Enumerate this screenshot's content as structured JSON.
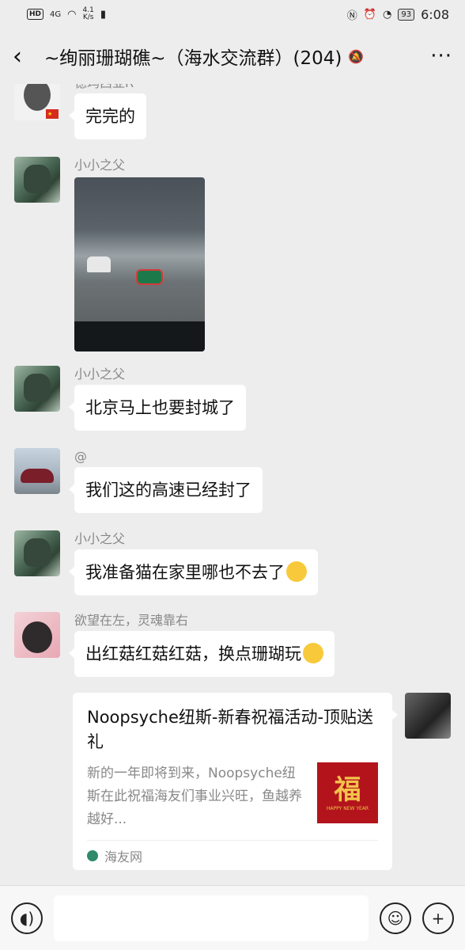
{
  "status_bar": {
    "hd": "HD",
    "network": "4G",
    "speed_value": "4.1",
    "speed_unit": "K/s",
    "battery": "93",
    "time": "6:08"
  },
  "header": {
    "back_icon": "chevron-left-icon",
    "title": "~绚丽珊瑚礁~（海水交流群）(204)",
    "mute_icon": "bell-muted-icon",
    "more_icon": "more-dots-icon",
    "more_label": "···"
  },
  "messages": [
    {
      "sender": "德玛西亚R",
      "text": "完完的"
    },
    {
      "sender": "小小之父",
      "type": "image"
    },
    {
      "sender": "小小之父",
      "text": "北京马上也要封城了"
    },
    {
      "sender": "@",
      "text": "我们这的高速已经封了"
    },
    {
      "sender": "小小之父",
      "text": "我准备猫在家里哪也不去了"
    },
    {
      "sender": "欲望在左，灵魂靠右",
      "text": "出红菇红菇红菇，换点珊瑚玩"
    }
  ],
  "share_card": {
    "title": "Noopsyche纽斯-新春祝福活动-顶贴送礼",
    "description": "新的一年即将到来，Noopsyche纽斯在此祝福海友们事业兴旺，鱼越养越好...",
    "thumb_text": "福",
    "thumb_caption": "HAPPY NEW YEAR",
    "source": "海友网"
  },
  "input_bar": {
    "voice_icon": "voice-icon",
    "emoji_icon": "emoji-icon",
    "plus_icon": "plus-icon",
    "placeholder": ""
  }
}
